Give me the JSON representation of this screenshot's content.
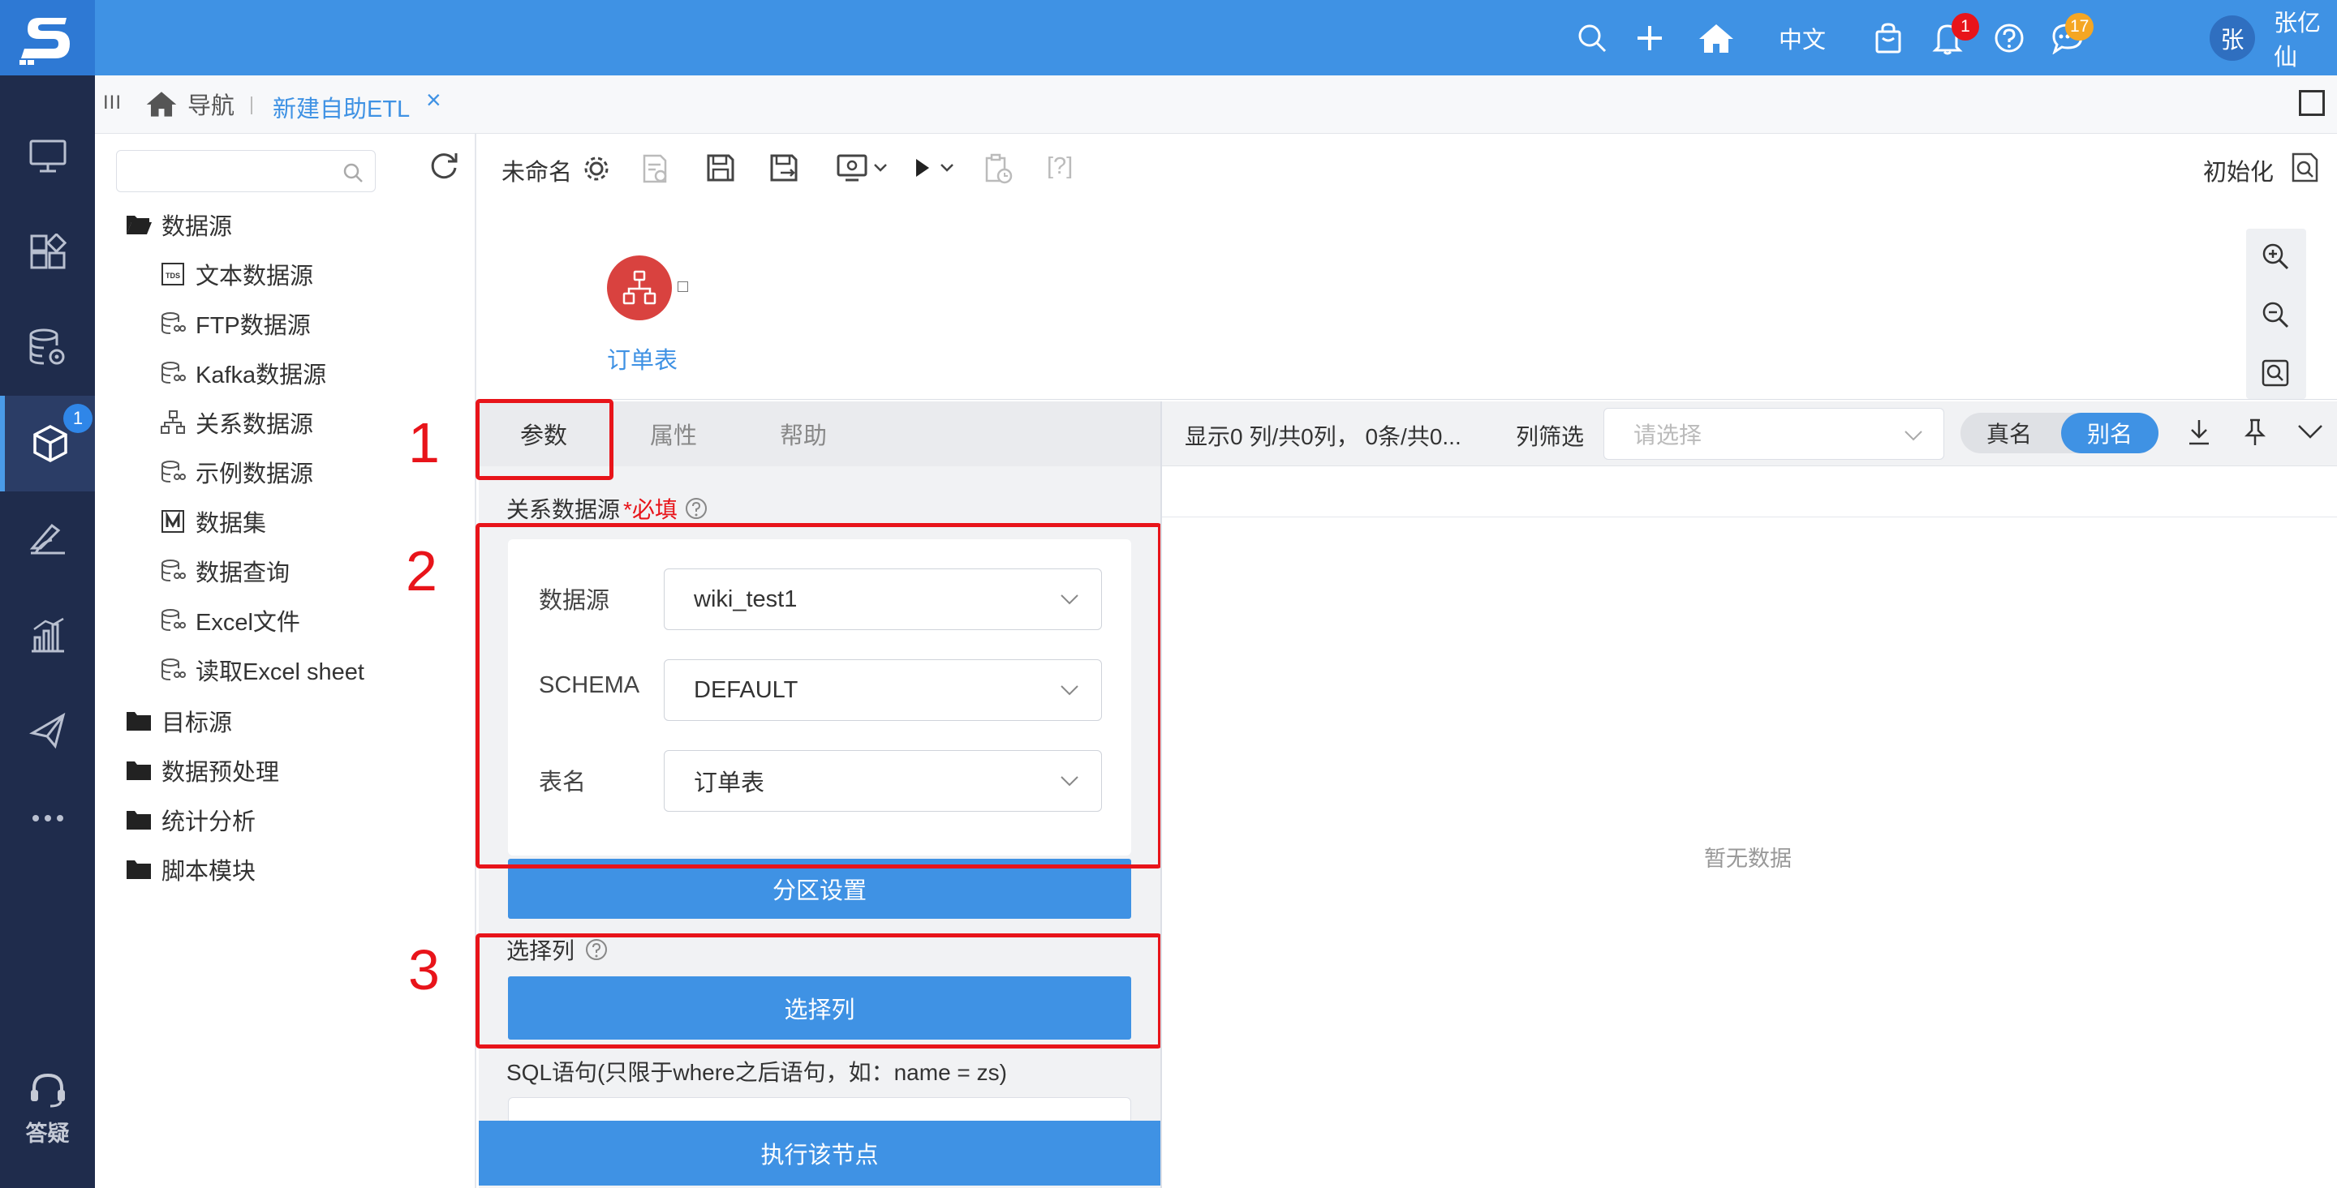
{
  "user": {
    "avatar_char": "张",
    "name": "张亿仙"
  },
  "topbar": {
    "language": "中文",
    "notification_count": "1",
    "message_count": "17"
  },
  "sidebar": {
    "badge_count": "1",
    "help_label": "答疑"
  },
  "tabstrip": {
    "menu_glyph": "III",
    "home_label": "导航",
    "active_tab": "新建自助ETL",
    "close_glyph": "×"
  },
  "tree": {
    "search_placeholder": "",
    "items": [
      {
        "label": "数据源",
        "icon": "folder-open-icon",
        "level": 0
      },
      {
        "label": "文本数据源",
        "icon": "tds-icon",
        "level": 1
      },
      {
        "label": "FTP数据源",
        "icon": "database-link-icon",
        "level": 1
      },
      {
        "label": "Kafka数据源",
        "icon": "database-link-icon",
        "level": 1
      },
      {
        "label": "关系数据源",
        "icon": "relation-icon",
        "level": 1
      },
      {
        "label": "示例数据源",
        "icon": "database-link-icon",
        "level": 1
      },
      {
        "label": "数据集",
        "icon": "dataset-icon",
        "level": 1
      },
      {
        "label": "数据查询",
        "icon": "database-link-icon",
        "level": 1
      },
      {
        "label": "Excel文件",
        "icon": "database-link-icon",
        "level": 1
      },
      {
        "label": "读取Excel sheet",
        "icon": "database-link-icon",
        "level": 1
      },
      {
        "label": "目标源",
        "icon": "folder-icon",
        "level": 0
      },
      {
        "label": "数据预处理",
        "icon": "folder-icon",
        "level": 0
      },
      {
        "label": "统计分析",
        "icon": "folder-icon",
        "level": 0
      },
      {
        "label": "脚本模块",
        "icon": "folder-icon",
        "level": 0
      }
    ]
  },
  "toolbar": {
    "title": "未命名",
    "help_glyph": "[?]",
    "init_label": "初始化"
  },
  "canvas": {
    "node_label": "订单表"
  },
  "param_tabs": [
    "参数",
    "属性",
    "帮助"
  ],
  "params": {
    "section_label": "关系数据源",
    "required_label": "*必填",
    "fields": [
      {
        "label": "数据源",
        "value": "wiki_test1"
      },
      {
        "label": "SCHEMA",
        "value": "DEFAULT"
      },
      {
        "label": "表名",
        "value": "订单表"
      }
    ],
    "partition_button": "分区设置",
    "select_cols_label": "选择列",
    "select_cols_button": "选择列",
    "sql_label": "SQL语句(只限于where之后语句，如：name = zs)",
    "execute_button": "执行该节点"
  },
  "annotations": [
    "1",
    "2",
    "3"
  ],
  "result": {
    "summary": "显示0 列/共0列，  0条/共0...",
    "filter_label": "列筛选",
    "filter_placeholder": "请选择",
    "toggle_real": "真名",
    "toggle_alias": "别名",
    "empty_text": "暂无数据"
  },
  "colors": {
    "topbar": "#3f92e4",
    "sidebar": "#1f2c4c",
    "accent": "#3f92e4",
    "annotation": "#e8141a",
    "node": "#d9423f"
  }
}
